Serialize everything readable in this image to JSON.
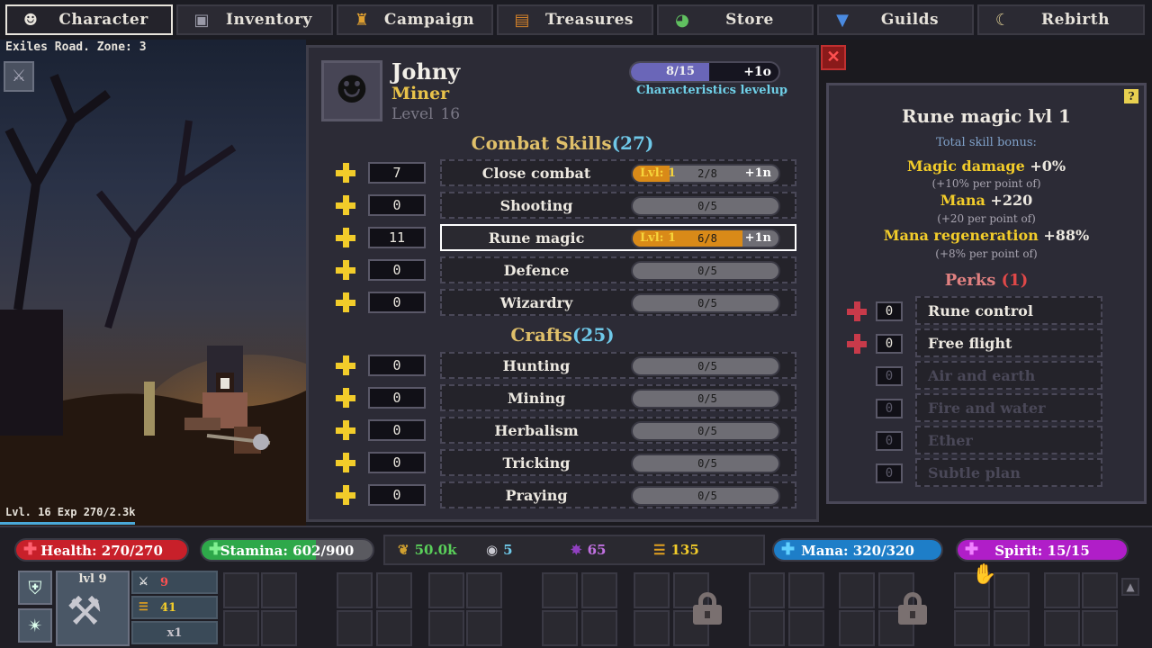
{
  "tabs": [
    {
      "label": "Character",
      "icon": "character-icon"
    },
    {
      "label": "Inventory",
      "icon": "inventory-icon"
    },
    {
      "label": "Campaign",
      "icon": "campaign-icon"
    },
    {
      "label": "Treasures",
      "icon": "treasures-icon"
    },
    {
      "label": "Store",
      "icon": "store-icon"
    },
    {
      "label": "Guilds",
      "icon": "guilds-icon"
    },
    {
      "label": "Rebirth",
      "icon": "rebirth-icon"
    }
  ],
  "scene": {
    "zone": "Exiles Road. Zone: 3",
    "level_exp": "Lvl. 16 Exp 270/2.3k"
  },
  "character": {
    "name": "Johny",
    "class": "Miner",
    "level_label": "Level",
    "level": "16",
    "char_bar": {
      "text": "8/15",
      "plus": "+1o",
      "progress": 0.53
    },
    "char_label": "Characteristics levelup"
  },
  "combat": {
    "title": "Combat Skills",
    "count": "(27)",
    "skills": [
      {
        "points": "7",
        "name": "Close combat",
        "lvl": "Lvl: 1",
        "prog": "2/8",
        "inc": "+1n",
        "progress": 0.25
      },
      {
        "points": "0",
        "name": "Shooting",
        "lvl": "",
        "prog": "0/5",
        "inc": "",
        "progress": 0
      },
      {
        "points": "11",
        "name": "Rune magic",
        "lvl": "Lvl: 1",
        "prog": "6/8",
        "inc": "+1n",
        "progress": 0.75
      },
      {
        "points": "0",
        "name": "Defence",
        "lvl": "",
        "prog": "0/5",
        "inc": "",
        "progress": 0
      },
      {
        "points": "0",
        "name": "Wizardry",
        "lvl": "",
        "prog": "0/5",
        "inc": "",
        "progress": 0
      }
    ]
  },
  "crafts": {
    "title": "Crafts",
    "count": "(25)",
    "skills": [
      {
        "points": "0",
        "name": "Hunting",
        "prog": "0/5"
      },
      {
        "points": "0",
        "name": "Mining",
        "prog": "0/5"
      },
      {
        "points": "0",
        "name": "Herbalism",
        "prog": "0/5"
      },
      {
        "points": "0",
        "name": "Tricking",
        "prog": "0/5"
      },
      {
        "points": "0",
        "name": "Praying",
        "prog": "0/5"
      }
    ]
  },
  "detail": {
    "title": "Rune magic lvl 1",
    "subtitle": "Total skill bonus:",
    "help": "?",
    "bonuses": [
      {
        "name": "Magic damage",
        "value": "+0%",
        "note": "(+10% per point of)"
      },
      {
        "name": "Mana",
        "value": "+220",
        "note": "(+20 per point of)"
      },
      {
        "name": "Mana regeneration",
        "value": "+88%",
        "note": "(+8% per point of)"
      }
    ],
    "perks_title": "Perks",
    "perks_count": "(1)",
    "perks": [
      {
        "points": "0",
        "name": "Rune control",
        "enabled": true
      },
      {
        "points": "0",
        "name": "Free flight",
        "enabled": true
      },
      {
        "points": "0",
        "name": "Air and earth",
        "enabled": false
      },
      {
        "points": "0",
        "name": "Fire and water",
        "enabled": false
      },
      {
        "points": "0",
        "name": "Ether",
        "enabled": false
      },
      {
        "points": "0",
        "name": "Subtle plan",
        "enabled": false
      }
    ]
  },
  "bars": {
    "health": {
      "text": "Health: 270/270",
      "progress": 1.0,
      "color": "#c8202a"
    },
    "stamina": {
      "text": "Stamina: 602/900",
      "progress": 0.67,
      "color": "#2ea84a"
    },
    "mana": {
      "text": "Mana: 320/320",
      "progress": 1.0,
      "color": "#1e7ec8"
    },
    "spirit": {
      "text": "Spirit: 15/15",
      "progress": 1.0,
      "color": "#b01ec8"
    }
  },
  "resources": [
    {
      "icon": "herb-icon",
      "value": "50.0k",
      "color": "#5ad05a"
    },
    {
      "icon": "orb-icon",
      "value": "5",
      "color": "#6fc8e8"
    },
    {
      "icon": "crystal-icon",
      "value": "65",
      "color": "#c070e0"
    },
    {
      "icon": "coins-icon",
      "value": "135",
      "color": "#f2cc2a"
    }
  ],
  "equipment": {
    "weapon_level": "lvl 9",
    "attack": "9",
    "gold": "41",
    "mult": "x1"
  }
}
